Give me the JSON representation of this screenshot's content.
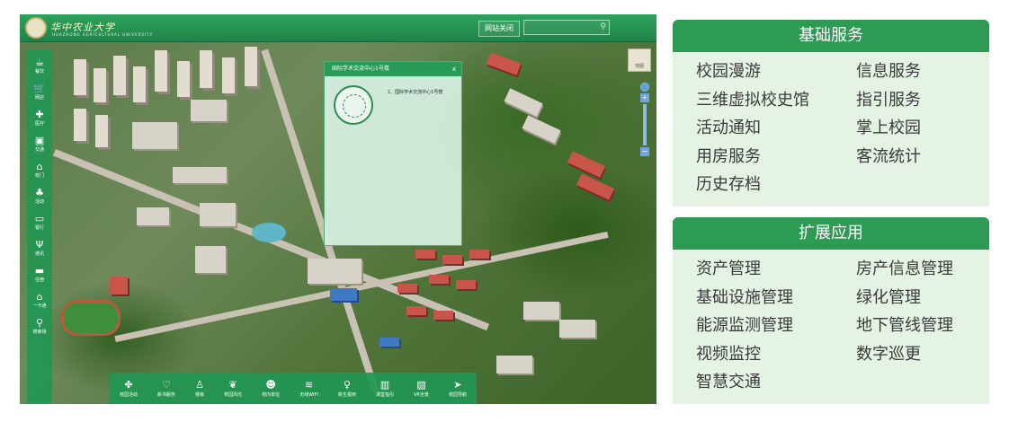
{
  "map": {
    "header": {
      "logo_text": "华中农业大学",
      "logo_subtext": "HUAZHONG AGRICULTURAL UNIVERSITY",
      "close_button": "网站关闭",
      "search_placeholder": ""
    },
    "side_toolbar": [
      {
        "icon": "cup-icon",
        "glyph": "☕",
        "label": "餐饮"
      },
      {
        "icon": "cart-icon",
        "glyph": "🛒",
        "label": "网店"
      },
      {
        "icon": "medical-kit-icon",
        "glyph": "✚",
        "label": "医疗"
      },
      {
        "icon": "bus-icon",
        "glyph": "▣",
        "label": "交通"
      },
      {
        "icon": "gate-icon",
        "glyph": "⌂",
        "label": "校门"
      },
      {
        "icon": "activity-icon",
        "glyph": "♣",
        "label": "活动"
      },
      {
        "icon": "card-icon",
        "glyph": "▭",
        "label": "银行"
      },
      {
        "icon": "antenna-icon",
        "glyph": "Ψ",
        "label": "通讯"
      },
      {
        "icon": "bed-icon",
        "glyph": "▬",
        "label": "住宿"
      },
      {
        "icon": "home-icon",
        "glyph": "⌂",
        "label": "一卡通"
      },
      {
        "icon": "search-icon",
        "glyph": "⚲",
        "label": "搜索场"
      }
    ],
    "popup": {
      "title": "国际学术交流中心1号楼",
      "close": "x",
      "item": "1、国际学术交流中心1号楼"
    },
    "map_thumb_label": "地图",
    "bottom_toolbar": [
      {
        "icon": "clover-icon",
        "glyph": "✤",
        "label": "校园活动"
      },
      {
        "icon": "heart-icon",
        "glyph": "♡",
        "label": "新书服务"
      },
      {
        "icon": "figure-icon",
        "glyph": "♙",
        "label": "楼栋"
      },
      {
        "icon": "plant-icon",
        "glyph": "❦",
        "label": "校园风光"
      },
      {
        "icon": "people-icon",
        "glyph": "☻",
        "label": "校内单位"
      },
      {
        "icon": "wifi-icon",
        "glyph": "≋",
        "label": "无线WIFI"
      },
      {
        "icon": "runner-icon",
        "glyph": "♀",
        "label": "新生报到"
      },
      {
        "icon": "book-icon",
        "glyph": "▥",
        "label": "课堂指引"
      },
      {
        "icon": "image-icon",
        "glyph": "▨",
        "label": "VR全景"
      },
      {
        "icon": "send-icon",
        "glyph": "➤",
        "label": "校园导航"
      }
    ]
  },
  "panels": {
    "basic": {
      "title": "基础服务",
      "items": [
        "校园漫游",
        "信息服务",
        "三维虚拟校史馆",
        "指引服务",
        "活动通知",
        "掌上校园",
        "用房服务",
        "客流统计",
        "历史存档"
      ]
    },
    "extended": {
      "title": "扩展应用",
      "items": [
        "资产管理",
        "房产信息管理",
        "基础设施管理",
        "绿化管理",
        "能源监测管理",
        "地下管线管理",
        "视频监控",
        "数字巡更",
        "智慧交通"
      ]
    }
  },
  "colors": {
    "accent": "#2e9b55",
    "panel_bg": "#e5f3e5",
    "map_green": "#1f8447"
  }
}
